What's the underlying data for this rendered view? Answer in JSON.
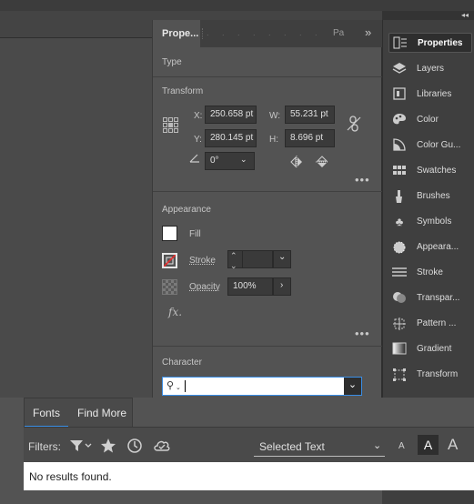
{
  "panel": {
    "tab_active": "Prope...",
    "tab_other": "Pa",
    "tab_more": "»",
    "sections": {
      "type": "Type",
      "transform": "Transform",
      "appearance": "Appearance",
      "character": "Character"
    }
  },
  "transform": {
    "x_label": "X:",
    "x_value": "250.658 pt",
    "y_label": "Y:",
    "y_value": "280.145 pt",
    "w_label": "W:",
    "w_value": "55.231 pt",
    "h_label": "H:",
    "h_value": "8.696 pt",
    "angle_value": "0°"
  },
  "appearance": {
    "fill_label": "Fill",
    "stroke_label": "Stroke",
    "opacity_label": "Opacity",
    "opacity_value": "100%",
    "fx_label": "fx."
  },
  "character": {
    "search_value": ""
  },
  "strip": {
    "collapse": "◂◂",
    "items": [
      {
        "label": "Properties",
        "icon": "properties-icon"
      },
      {
        "label": "Layers",
        "icon": "layers-icon"
      },
      {
        "label": "Libraries",
        "icon": "libraries-icon"
      },
      {
        "label": "Color",
        "icon": "color-icon"
      },
      {
        "label": "Color Gu...",
        "icon": "color-guide-icon"
      },
      {
        "label": "Swatches",
        "icon": "swatches-icon"
      },
      {
        "label": "Brushes",
        "icon": "brushes-icon"
      },
      {
        "label": "Symbols",
        "icon": "symbols-icon"
      },
      {
        "label": "Appeara...",
        "icon": "appearance-icon"
      },
      {
        "label": "Stroke",
        "icon": "stroke-icon"
      },
      {
        "label": "Transpar...",
        "icon": "transparency-icon"
      },
      {
        "label": "Pattern ...",
        "icon": "pattern-icon"
      },
      {
        "label": "Gradient",
        "icon": "gradient-icon"
      },
      {
        "label": "Transform",
        "icon": "transform-icon"
      }
    ]
  },
  "fonts_popup": {
    "tab_fonts": "Fonts",
    "tab_find_more": "Find More",
    "filters_label": "Filters:",
    "sample_select": "Selected Text",
    "size_small": "A",
    "size_medium": "A",
    "size_large": "A",
    "results_text": "No results found."
  },
  "colors": {
    "panel_bg": "#535353",
    "strip_bg": "#3f3f3f",
    "active_tab_underline": "#3a8ee6",
    "stroke_slash": "#e03030"
  }
}
